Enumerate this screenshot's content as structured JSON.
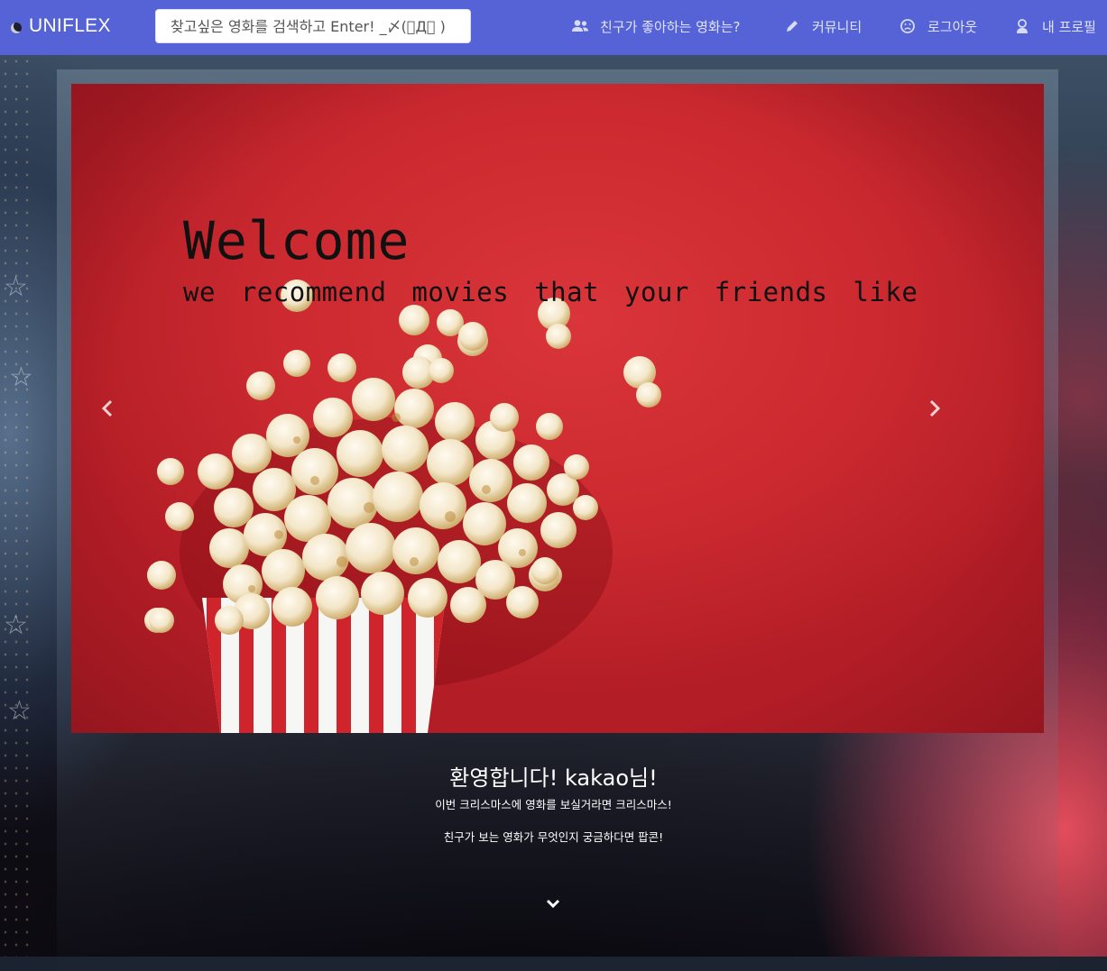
{
  "navbar": {
    "brand": "UNIFLEX",
    "search": {
      "placeholder": "찾고싶은 영화를 검색하고 Enter! _〆(゚Д゚ )"
    },
    "items": [
      {
        "label": "친구가 좋아하는 영화는?",
        "icon": "users-icon"
      },
      {
        "label": "커뮤니티",
        "icon": "pencil-icon"
      },
      {
        "label": "로그아웃",
        "icon": "sad-face-icon"
      },
      {
        "label": "내 프로필",
        "icon": "user-badge-icon"
      }
    ],
    "color": "#5563d6"
  },
  "carousel": {
    "slide": {
      "title": "Welcome",
      "subtitle": "we recommend movies that your friends like"
    },
    "prev_icon": "chevron-left-icon",
    "next_icon": "chevron-right-icon"
  },
  "caption": {
    "greeting": "환영합니다! kakao님!",
    "line1": "이번 크리스마스에 영화를 보실거라면 크리스마스!",
    "line2": "친구가 보는 영화가 무엇인지 궁금하다면 팝콘!",
    "scroll_icon": "chevron-down-icon"
  }
}
